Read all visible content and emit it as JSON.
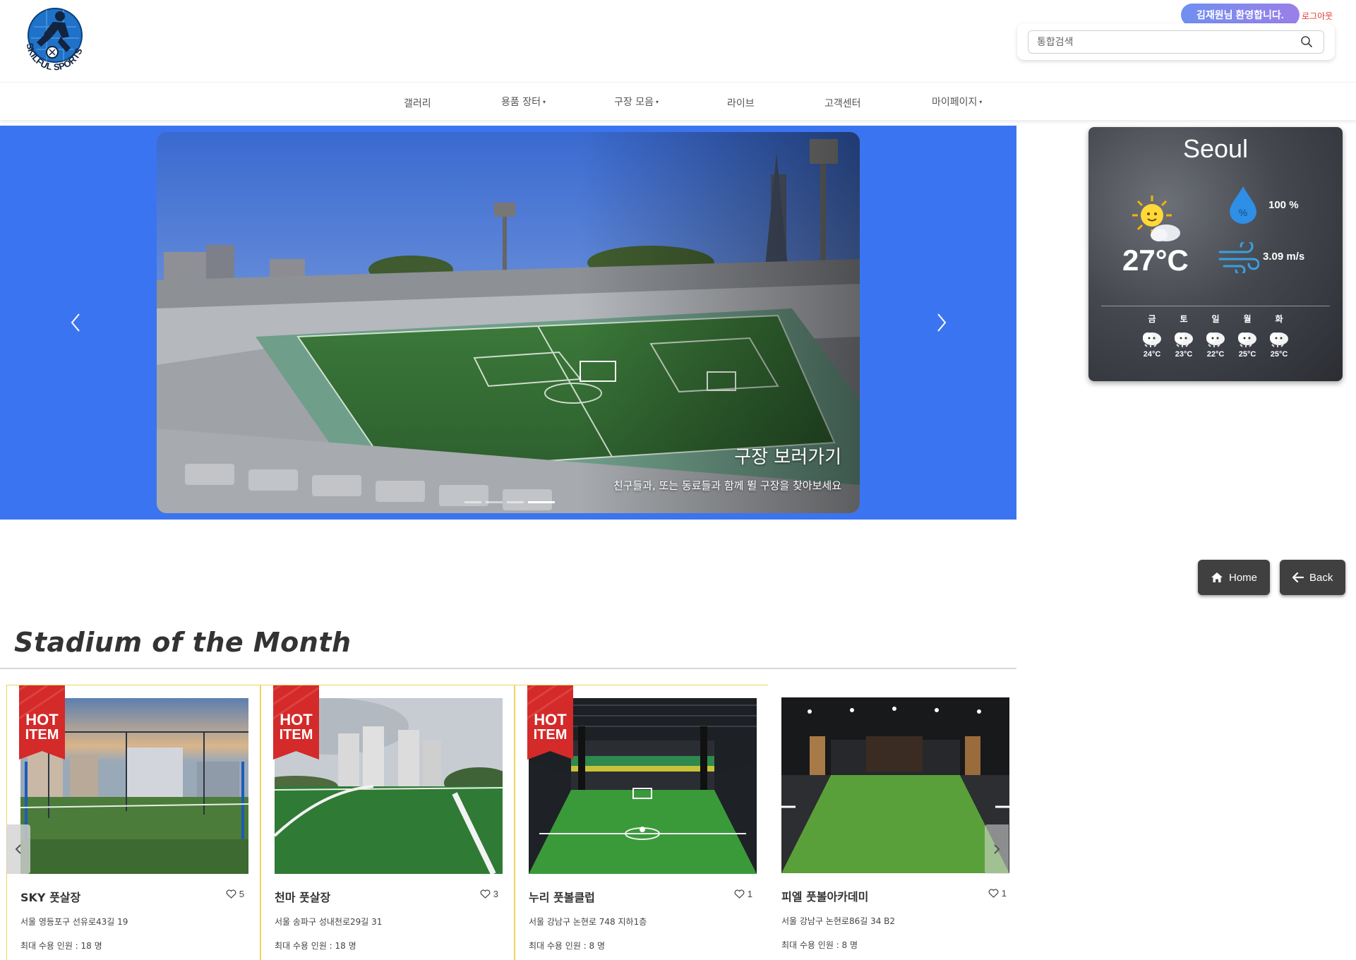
{
  "header": {
    "logo_text": "SKILFUL SPORTS",
    "welcome": "김재원님 환영합니다.",
    "logout": "로그아웃",
    "search_placeholder": "통합검색"
  },
  "nav": {
    "items": [
      {
        "label": "갤러리",
        "dropdown": false
      },
      {
        "label": "용품 장터",
        "dropdown": true
      },
      {
        "label": "구장 모음",
        "dropdown": true
      },
      {
        "label": "라이브",
        "dropdown": false
      },
      {
        "label": "고객센터",
        "dropdown": false
      },
      {
        "label": "마이페이지",
        "dropdown": true
      }
    ],
    "caret": "▾"
  },
  "hero": {
    "caption_title": "구장 보러가기",
    "caption_sub": "친구들과, 또는 동료들과 함께 뛸 구장을 찾아보세요",
    "slide_count": 4,
    "active_slide": 4,
    "bg_color": "#3b74f0"
  },
  "weather": {
    "city": "Seoul",
    "temp": "27°C",
    "humidity": "100 %",
    "wind": "3.09 m/s",
    "forecast": [
      {
        "day": "금",
        "temp": "24°C"
      },
      {
        "day": "토",
        "temp": "23°C"
      },
      {
        "day": "일",
        "temp": "22°C"
      },
      {
        "day": "월",
        "temp": "25°C"
      },
      {
        "day": "화",
        "temp": "25°C"
      }
    ]
  },
  "buttons": {
    "home": "Home",
    "back": "Back"
  },
  "section": {
    "title": "Stadium of the Month"
  },
  "ribbon_text": [
    "HOT",
    "ITEM"
  ],
  "stadiums": [
    {
      "name": "SKY 풋살장",
      "likes": "5",
      "address": "서울 영등포구 선유로43길 19",
      "capacity": "최대 수용 인원 : 18 명",
      "hot": true
    },
    {
      "name": "천마 풋살장",
      "likes": "3",
      "address": "서울 송파구 성내천로29길 31",
      "capacity": "최대 수용 인원 : 18 명",
      "hot": true
    },
    {
      "name": "누리 풋볼클럽",
      "likes": "1",
      "address": "서울 강남구 논현로 748 지하1층",
      "capacity": "최대 수용 인원 : 8 명",
      "hot": true
    },
    {
      "name": "피엘 풋볼아카데미",
      "likes": "1",
      "address": "서울 강남구 논현로86길 34 B2",
      "capacity": "최대 수용 인원 : 8 명",
      "hot": false
    }
  ],
  "colors": {
    "accent_blue": "#3b74f0",
    "welcome_gradient": [
      "#6f8ff0",
      "#9b7fe8"
    ],
    "logout": "#e53935",
    "hot_border": "#f0d45a",
    "ribbon_red": "#d42a2a"
  }
}
